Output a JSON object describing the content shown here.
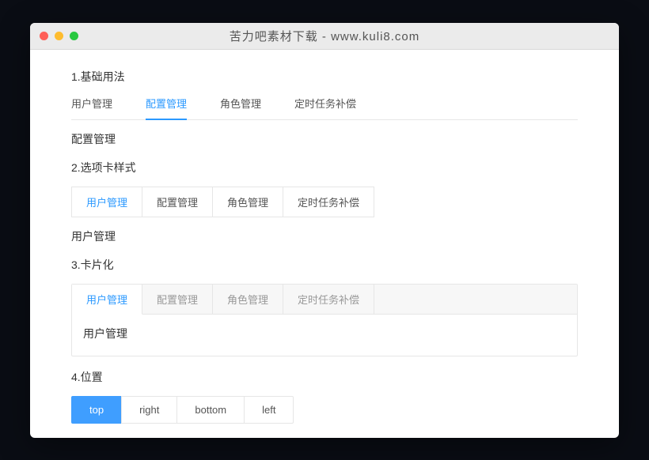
{
  "window": {
    "title": "苦力吧素材下载 - www.kuli8.com"
  },
  "section1": {
    "heading": "1.基础用法",
    "tabs": [
      "用户管理",
      "配置管理",
      "角色管理",
      "定时任务补偿"
    ],
    "active_index": 1,
    "content": "配置管理"
  },
  "section2": {
    "heading": "2.选项卡样式",
    "tabs": [
      "用户管理",
      "配置管理",
      "角色管理",
      "定时任务补偿"
    ],
    "active_index": 0,
    "content": "用户管理"
  },
  "section3": {
    "heading": "3.卡片化",
    "tabs": [
      "用户管理",
      "配置管理",
      "角色管理",
      "定时任务补偿"
    ],
    "active_index": 0,
    "content": "用户管理"
  },
  "section4": {
    "heading": "4.位置",
    "buttons": [
      "top",
      "right",
      "bottom",
      "left"
    ],
    "active_index": 0
  }
}
